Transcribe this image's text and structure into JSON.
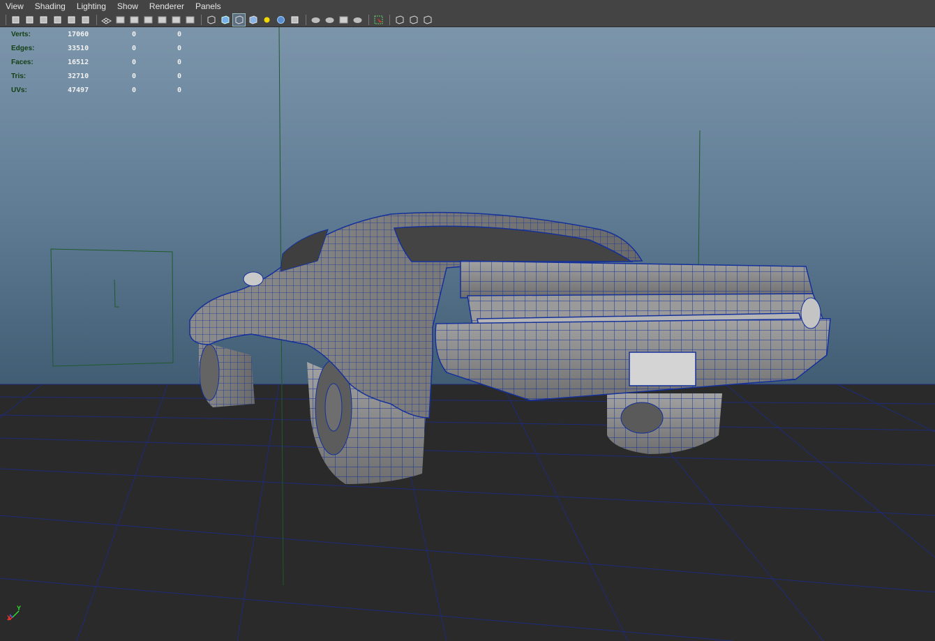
{
  "menu": {
    "items": [
      "View",
      "Shading",
      "Lighting",
      "Show",
      "Renderer",
      "Panels"
    ]
  },
  "toolbar": {
    "groups": [
      [
        "camera-select-icon",
        "camera-attributes-icon",
        "bookmark-icon",
        "image-plane-icon",
        "two-d-pan-zoom-icon",
        "grease-pencil-icon"
      ],
      [
        "grid-icon",
        "film-gate-icon",
        "resolution-gate-icon",
        "gate-mask-icon",
        "field-chart-icon",
        "safe-action-icon",
        "safe-title-icon"
      ],
      [
        "wireframe-icon",
        "smooth-shade-icon",
        "wireframe-on-shaded-icon",
        "textured-icon",
        "use-lights-icon",
        "shadows-icon",
        "high-quality-icon"
      ],
      [
        "ambient-occlusion-icon",
        "motion-blur-icon",
        "depth-of-field-icon",
        "anti-alias-icon"
      ],
      [
        "isolate-select-icon"
      ],
      [
        "xray-icon",
        "xray-joints-icon",
        "xray-components-icon"
      ]
    ],
    "active": "wireframe-on-shaded-icon"
  },
  "hud": {
    "rows": [
      {
        "label": "Verts:",
        "total": "17060",
        "selected": "0",
        "third": "0"
      },
      {
        "label": "Edges:",
        "total": "33510",
        "selected": "0",
        "third": "0"
      },
      {
        "label": "Faces:",
        "total": "16512",
        "selected": "0",
        "third": "0"
      },
      {
        "label": "Tris:",
        "total": "32710",
        "selected": "0",
        "third": "0"
      },
      {
        "label": "UVs:",
        "total": "47497",
        "selected": "0",
        "third": "0"
      }
    ]
  },
  "axis": {
    "y_label": "Y",
    "x_label": "X"
  },
  "colors": {
    "menubar": "#444444",
    "viewport_top": "#7c95ab",
    "viewport_bottom": "#304657",
    "floor": "#2a2a2a",
    "grid_line": "#1e2a78",
    "wire": "#14309a",
    "car_body": "#8a8a8a",
    "hud_label": "#123f12",
    "hud_value": "#f2f2f2"
  }
}
